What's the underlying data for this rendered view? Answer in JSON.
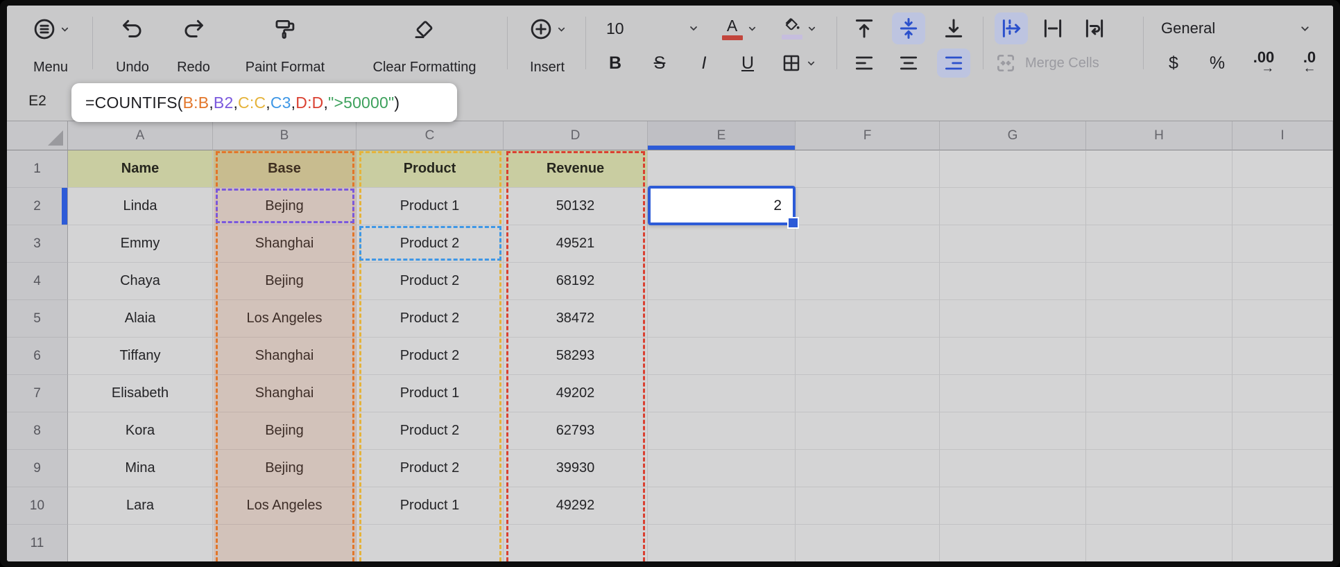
{
  "toolbar": {
    "menu_label": "Menu",
    "undo_label": "Undo",
    "redo_label": "Redo",
    "paint_format_label": "Paint Format",
    "clear_formatting_label": "Clear Formatting",
    "insert_label": "Insert",
    "font_size_value": "10",
    "font_color_label": "A",
    "bold_label": "B",
    "strikethrough_label": "S",
    "italic_label": "I",
    "underline_label": "U",
    "merge_cells_label": "Merge Cells",
    "number_format_value": "General",
    "currency_label": "$",
    "percent_label": "%",
    "increase_decimal_label": ".00",
    "increase_decimal_arrow": "→",
    "decrease_decimal_label": ".0",
    "decrease_decimal_arrow": "←"
  },
  "formula_bar": {
    "name_box": "E2",
    "formula_parts": [
      {
        "text": "=COUNTIFS(",
        "color": "default"
      },
      {
        "text": "B:B",
        "color": "orange"
      },
      {
        "text": ",",
        "color": "default"
      },
      {
        "text": "B2",
        "color": "purple"
      },
      {
        "text": ",",
        "color": "default"
      },
      {
        "text": "C:C",
        "color": "gold"
      },
      {
        "text": ",",
        "color": "default"
      },
      {
        "text": "C3",
        "color": "blue"
      },
      {
        "text": ",",
        "color": "default"
      },
      {
        "text": "D:D",
        "color": "red"
      },
      {
        "text": ",",
        "color": "default"
      },
      {
        "text": "\">50000\"",
        "color": "green"
      },
      {
        "text": ")",
        "color": "default"
      }
    ]
  },
  "grid": {
    "columns": [
      "A",
      "B",
      "C",
      "D",
      "E",
      "F",
      "G",
      "H",
      "I"
    ],
    "active_column": "E",
    "active_row": 2,
    "active_cell": {
      "ref": "E2",
      "value": "2"
    },
    "rows": [
      {
        "n": "1",
        "header": true,
        "cells": [
          "Name",
          "Base",
          "Product",
          "Revenue"
        ]
      },
      {
        "n": "2",
        "cells": [
          "Linda",
          "Bejing",
          "Product 1",
          "50132"
        ]
      },
      {
        "n": "3",
        "cells": [
          "Emmy",
          "Shanghai",
          "Product 2",
          "49521"
        ]
      },
      {
        "n": "4",
        "cells": [
          "Chaya",
          "Bejing",
          "Product 2",
          "68192"
        ]
      },
      {
        "n": "5",
        "cells": [
          "Alaia",
          "Los Angeles",
          "Product 2",
          "38472"
        ]
      },
      {
        "n": "6",
        "cells": [
          "Tiffany",
          "Shanghai",
          "Product 2",
          "58293"
        ]
      },
      {
        "n": "7",
        "cells": [
          "Elisabeth",
          "Shanghai",
          "Product 1",
          "49202"
        ]
      },
      {
        "n": "8",
        "cells": [
          "Kora",
          "Bejing",
          "Product 2",
          "62793"
        ]
      },
      {
        "n": "9",
        "cells": [
          "Mina",
          "Bejing",
          "Product 2",
          "39930"
        ]
      },
      {
        "n": "10",
        "cells": [
          "Lara",
          "Los Angeles",
          "Product 1",
          "49292"
        ]
      },
      {
        "n": "11",
        "cells": [
          "",
          "",
          "",
          ""
        ]
      }
    ]
  },
  "colors": {
    "accent_blue": "#2d5bd7",
    "ref_orange": "#e2762a",
    "ref_purple": "#7a58dd",
    "ref_gold": "#e5b33a",
    "ref_blue": "#3e97e6",
    "ref_red": "#da4031",
    "ref_green": "#3da15c",
    "header_row_fill": "#c9cda1"
  }
}
